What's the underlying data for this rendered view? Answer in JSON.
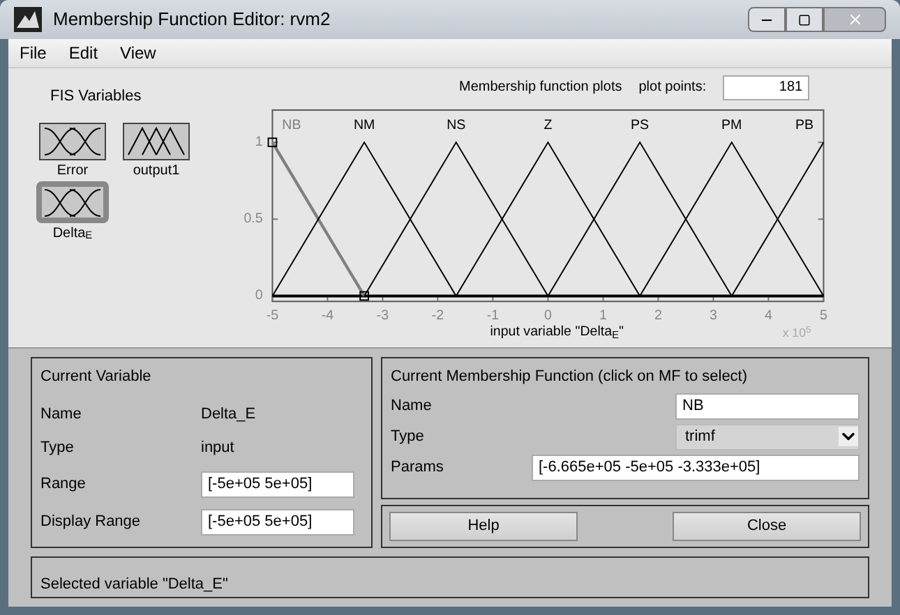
{
  "window": {
    "title": "Membership Function Editor: rvm2"
  },
  "menu": [
    "File",
    "Edit",
    "View"
  ],
  "fis_variables": {
    "title": "FIS Variables",
    "items": [
      {
        "name": "Error",
        "kind": "input",
        "selected": false
      },
      {
        "name": "output1",
        "kind": "output",
        "selected": false
      },
      {
        "name": "Delta$_{E}$",
        "kind": "input",
        "selected": true
      }
    ]
  },
  "plot": {
    "title": "Membership function plots",
    "plot_points_label": "plot points:",
    "plot_points": "181",
    "chart_data": {
      "type": "line",
      "xlabel": "input variable \"Delta$_{E}$\"",
      "x": [
        -5,
        -3.333,
        -1.667,
        0,
        1.667,
        3.333,
        5
      ],
      "series": [
        {
          "name": "NB",
          "color": "#808080",
          "values": [
            1,
            0,
            null,
            null,
            null,
            null,
            null
          ]
        },
        {
          "name": "NM",
          "color": "#000000",
          "values": [
            0,
            1,
            0,
            null,
            null,
            null,
            null
          ]
        },
        {
          "name": "NS",
          "color": "#000000",
          "values": [
            null,
            0,
            1,
            0,
            null,
            null,
            null
          ]
        },
        {
          "name": "Z",
          "color": "#000000",
          "values": [
            null,
            null,
            0,
            1,
            0,
            null,
            null
          ]
        },
        {
          "name": "PS",
          "color": "#000000",
          "values": [
            null,
            null,
            null,
            0,
            1,
            0,
            null
          ]
        },
        {
          "name": "PM",
          "color": "#000000",
          "values": [
            null,
            null,
            null,
            null,
            0,
            1,
            0
          ]
        },
        {
          "name": "PB",
          "color": "#000000",
          "values": [
            null,
            null,
            null,
            null,
            null,
            0,
            1
          ]
        }
      ],
      "ref_lines": [
        {
          "axis": "y",
          "value": 0
        }
      ],
      "xlim": [
        -5,
        5
      ],
      "ylim": [
        0,
        1.21
      ],
      "xticks": [
        -5,
        -4,
        -3,
        -2,
        -1,
        0,
        1,
        2,
        3,
        4,
        5
      ],
      "yticks": [
        0,
        0.5,
        1
      ],
      "annotations": [
        "x 10$^{5}$"
      ]
    },
    "mf_selection": [
      {
        "selected": true
      },
      {
        "selected": false
      },
      {
        "selected": false
      },
      {
        "selected": false
      },
      {
        "selected": false
      },
      {
        "selected": false
      },
      {
        "selected": false
      }
    ]
  },
  "current_variable": {
    "title": "Current Variable",
    "name_label": "Name",
    "name": "Delta_E",
    "type_label": "Type",
    "type": "input",
    "range_label": "Range",
    "range": "[-5e+05 5e+05]",
    "display_range_label": "Display Range",
    "display_range": "[-5e+05 5e+05]"
  },
  "current_mf": {
    "title": "Current Membership Function (click on MF to select)",
    "name_label": "Name",
    "name": "NB",
    "type_label": "Type",
    "type": "trimf",
    "params_label": "Params",
    "params": "[-6.665e+05 -5e+05 -3.333e+05]"
  },
  "buttons": [
    "Help",
    "Close"
  ],
  "status": "Selected variable \"Delta_E\""
}
